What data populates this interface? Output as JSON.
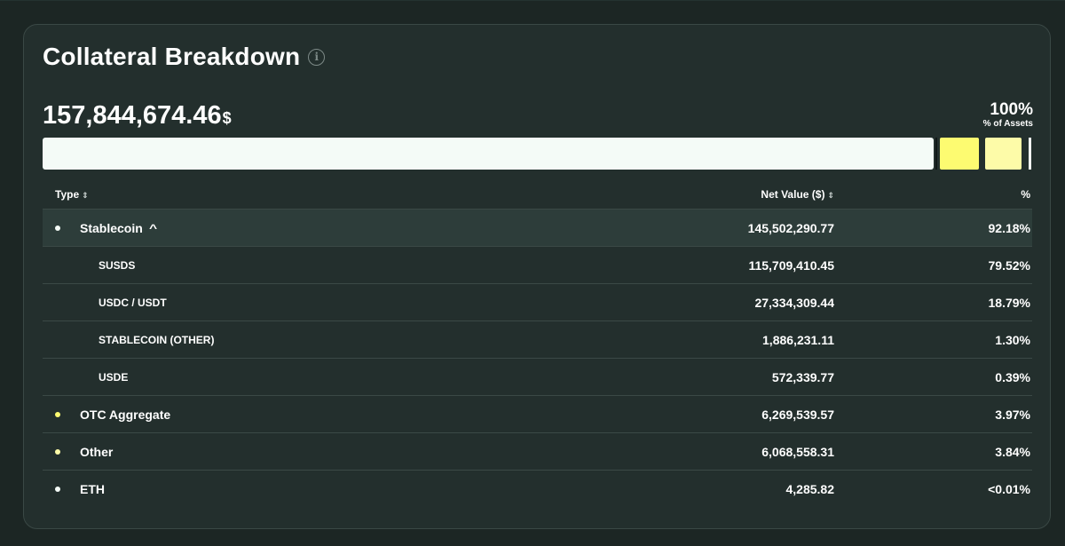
{
  "card": {
    "title": "Collateral Breakdown",
    "info_icon": "info-icon",
    "total_value": "157,844,674.46",
    "total_unit": "$",
    "pct_value": "100%",
    "pct_label": "% of Assets"
  },
  "allocation_bar": {
    "segments": [
      {
        "name": "Stablecoin",
        "fraction": 0.9218,
        "color": "#f4fbf7"
      },
      {
        "name": "OTC Aggregate",
        "fraction": 0.0397,
        "color": "#fdfb71"
      },
      {
        "name": "Other",
        "fraction": 0.0384,
        "color": "#fdfba8"
      },
      {
        "name": "ETH",
        "fraction": 0.0001,
        "color": "#f4fbf7"
      }
    ]
  },
  "table": {
    "headers": {
      "type": "Type",
      "net_value": "Net Value ($)",
      "pct": "%",
      "sort_icon": "⇕"
    },
    "rows": [
      {
        "type": "Stablecoin",
        "net_value": "145,502,290.77",
        "pct": "92.18%",
        "dot_color": "#f4fbf7",
        "expanded": true
      },
      {
        "type": "SUSDS",
        "net_value": "115,709,410.45",
        "pct": "79.52%"
      },
      {
        "type": "USDC / USDT",
        "net_value": "27,334,309.44",
        "pct": "18.79%"
      },
      {
        "type": "STABLECOIN (OTHER)",
        "net_value": "1,886,231.11",
        "pct": "1.30%"
      },
      {
        "type": "USDE",
        "net_value": "572,339.77",
        "pct": "0.39%"
      },
      {
        "type": "OTC Aggregate",
        "net_value": "6,269,539.57",
        "pct": "3.97%",
        "dot_color": "#fdfb71"
      },
      {
        "type": "Other",
        "net_value": "6,068,558.31",
        "pct": "3.84%",
        "dot_color": "#fdfba8"
      },
      {
        "type": "ETH",
        "net_value": "4,285.82",
        "pct": "<0.01%",
        "dot_color": "#f4fbf7"
      }
    ]
  }
}
